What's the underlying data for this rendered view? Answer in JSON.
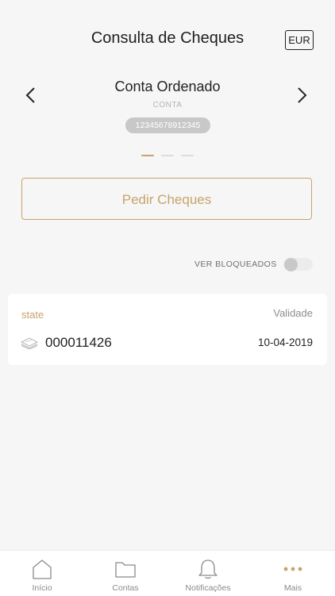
{
  "header": {
    "title": "Consulta de Cheques",
    "currency": "EUR"
  },
  "account": {
    "name": "Conta Ordenado",
    "type": "CONTA",
    "number": "12345678912345"
  },
  "actions": {
    "order_cheques": "Pedir Cheques"
  },
  "filters": {
    "show_blocked_label": "VER BLOQUEADOS",
    "show_blocked": false
  },
  "cheque_list": {
    "state_label": "state",
    "validity_label": "Validade",
    "items": [
      {
        "number": "000011426",
        "date": "10-04-2019"
      }
    ]
  },
  "tabbar": {
    "items": [
      {
        "label": "Início",
        "icon": "home-icon"
      },
      {
        "label": "Contas",
        "icon": "folder-icon"
      },
      {
        "label": "Notificações",
        "icon": "bell-icon"
      },
      {
        "label": "Mais",
        "icon": "more-icon"
      }
    ],
    "active": "Mais"
  },
  "colors": {
    "accent": "#c8a36b",
    "background": "#f6f6f6"
  }
}
